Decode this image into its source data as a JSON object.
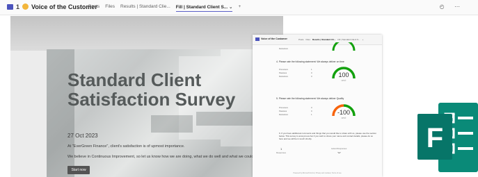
{
  "header": {
    "channel_number": "1",
    "team_name": "Voice of the Customer",
    "tabs": [
      {
        "label": "Posts"
      },
      {
        "label": "Files"
      },
      {
        "label": "Results | Standard Clie..."
      },
      {
        "label": "Fill | Standard Client S...",
        "suffix": "⌄"
      },
      {
        "label": "+"
      }
    ],
    "right_icons": "◴ ⋯"
  },
  "survey": {
    "title": "Standard Client Satisfaction Survey",
    "date": "27 Oct 2023",
    "desc1": "At \"EverGreen Finance\", client's satisfaction is of upmost importance.",
    "desc2": "We believe in Continuous Improvement, so let us know how we are doing, what we do well and what we could",
    "start_label": "Start now"
  },
  "results": {
    "team_name": "Voice of the Customer",
    "tabs": [
      "Posts",
      "Files",
      "Results | Standard Cli...",
      "Fill | Standard Client S...",
      "+"
    ],
    "q0_row": "Detractors",
    "q4": {
      "question": "4. Please rate the following statement: We always deliver on time",
      "rows": [
        {
          "label": "Promoters",
          "value": "1"
        },
        {
          "label": "Passives",
          "value": "0"
        },
        {
          "label": "Detractors",
          "value": "0"
        }
      ],
      "score": "100",
      "score_label": "NPS®"
    },
    "q5": {
      "question": "5. Please rate the following statement: We always deliver Quality",
      "rows": [
        {
          "label": "Promoters",
          "value": "0"
        },
        {
          "label": "Passives",
          "value": "0"
        },
        {
          "label": "Detractors",
          "value": "1"
        }
      ],
      "score": "-100",
      "score_label": "NPS®"
    },
    "q6": {
      "question": "6. If you have additional comments and things that you would like to share with us, please use the section below. This survey is anonymous but if you wish to share your name and contact details, please do so here and we will be in touch shortly.",
      "responses_count": "1",
      "responses_label": "Responses",
      "latest_label": "Latest Responses",
      "latest_value": "\"Hi\""
    },
    "footer": "Powered by Microsoft Forms | Privacy and cookies | Terms of use"
  },
  "colors": {
    "teams_purple": "#4b53bc",
    "forms_green": "#077568",
    "gauge_green": "#13a10e",
    "gauge_orange": "#f7630c"
  },
  "forms_logo": {
    "letter": "F",
    "icon": "microsoft-forms-icon"
  }
}
